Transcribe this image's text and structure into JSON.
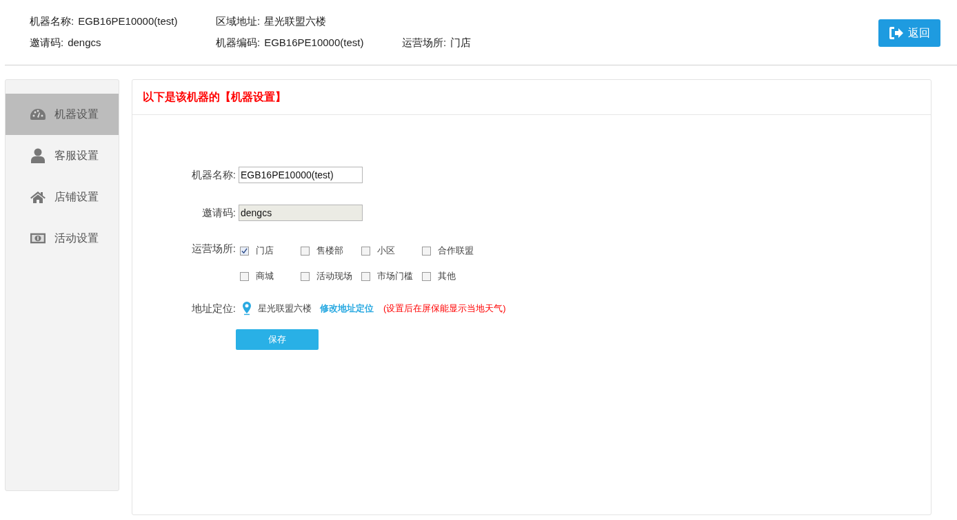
{
  "header": {
    "rows": [
      [
        {
          "label": "机器名称:",
          "value": "EGB16PE10000(test)"
        },
        {
          "label": "区域地址:",
          "value": "星光联盟六楼"
        }
      ],
      [
        {
          "label": "邀请码:",
          "value": "dengcs"
        },
        {
          "label": "机器编码:",
          "value": "EGB16PE10000(test)"
        },
        {
          "label": "运营场所:",
          "value": "门店"
        }
      ]
    ],
    "back_button": "返回"
  },
  "sidebar": {
    "items": [
      {
        "kind": "gauge",
        "label": "机器设置",
        "selected": true
      },
      {
        "kind": "user",
        "label": "客服设置",
        "selected": false
      },
      {
        "kind": "home",
        "label": "店铺设置",
        "selected": false
      },
      {
        "kind": "money",
        "label": "活动设置",
        "selected": false
      }
    ]
  },
  "panel": {
    "title": "以下是该机器的【机器设置】",
    "name_field": {
      "label": "机器名称:",
      "value": "EGB16PE10000(test)",
      "disabled": false
    },
    "invite_field": {
      "label": "邀请码:",
      "value": "dengcs",
      "disabled": true
    },
    "venue": {
      "label": "运营场所:",
      "options": [
        {
          "label": "门店",
          "checked": true
        },
        {
          "label": "售楼部",
          "checked": false
        },
        {
          "label": "小区",
          "checked": false
        },
        {
          "label": "合作联盟",
          "checked": false
        },
        {
          "label": "商城",
          "checked": false
        },
        {
          "label": "活动现场",
          "checked": false
        },
        {
          "label": "市场门槛",
          "checked": false
        },
        {
          "label": "其他",
          "checked": false
        }
      ]
    },
    "location": {
      "label": "地址定位:",
      "value": "星光联盟六楼",
      "link": "修改地址定位",
      "hint": "(设置后在屏保能显示当地天气)"
    },
    "save_button": "保存"
  }
}
